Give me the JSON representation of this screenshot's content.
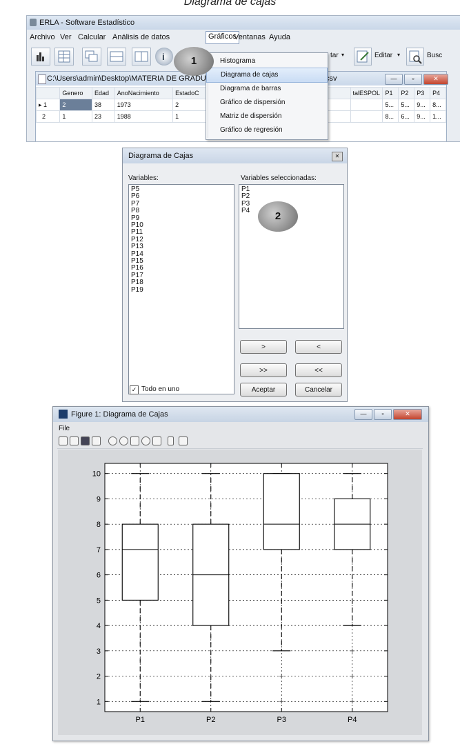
{
  "page_title": "Diagrama de cajas",
  "erla": {
    "title": "ERLA - Software Estadístico",
    "menu": [
      "Archivo",
      "Ver",
      "Calcular",
      "Análisis de datos",
      "Gráficos",
      "Ventanas",
      "Ayuda"
    ],
    "toolbar": {
      "editar_label": "Editar",
      "buscar_label": "Busc",
      "tar_label": "tar"
    },
    "data_window": {
      "title": "C:\\Users\\admin\\Desktop\\MATERIA DE GRADU",
      "title_suffix": "csv",
      "columns": [
        "Genero",
        "Edad",
        "AnoNacimiento",
        "EstadoC",
        "talESPOL",
        "P1",
        "P2",
        "P3",
        "P4"
      ],
      "rows": [
        {
          "idx": "1",
          "genero": "2",
          "edad": "38",
          "ano": "1973",
          "estado": "2",
          "p1": "5...",
          "p2": "5...",
          "p3": "9...",
          "p4": "8..."
        },
        {
          "idx": "2",
          "genero": "1",
          "edad": "23",
          "ano": "1988",
          "estado": "1",
          "p1": "8...",
          "p2": "6...",
          "p3": "9...",
          "p4": "1..."
        }
      ]
    }
  },
  "graficos_menu": {
    "items": [
      "Histograma",
      "Diagrama de cajas",
      "Diagrama de barras",
      "Gráfico de dispersión",
      "Matriz de dispersión",
      "Gráfico de regresión"
    ],
    "highlighted_index": 1
  },
  "badges": {
    "one": "1",
    "two": "2"
  },
  "dialog": {
    "title": "Diagrama de Cajas",
    "variables_label": "Variables:",
    "selected_label": "Variables seleccionadas:",
    "variables": [
      "P5",
      "P6",
      "P7",
      "P8",
      "P9",
      "P10",
      "P11",
      "P12",
      "P13",
      "P14",
      "P15",
      "P16",
      "P17",
      "P18",
      "P19"
    ],
    "selected": [
      "P1",
      "P2",
      "P3",
      "P4"
    ],
    "buttons": {
      "add": ">",
      "remove": "<",
      "add_all": ">>",
      "remove_all": "<<",
      "accept": "Aceptar",
      "cancel": "Cancelar"
    },
    "todo_en_uno": {
      "label": "Todo en uno",
      "checked": true
    }
  },
  "figure": {
    "title": "Figure 1: Diagrama de Cajas",
    "menu_file": "File"
  },
  "chart_data": {
    "type": "box",
    "categories": [
      "P1",
      "P2",
      "P3",
      "P4"
    ],
    "boxes": [
      {
        "name": "P1",
        "min": 1,
        "q1": 5,
        "median": 7,
        "q3": 8,
        "max": 10,
        "outliers": []
      },
      {
        "name": "P2",
        "min": 1,
        "q1": 4,
        "median": 6,
        "q3": 8,
        "max": 10,
        "outliers": []
      },
      {
        "name": "P3",
        "min": 3,
        "q1": 7,
        "median": 8,
        "q3": 10,
        "max": 10,
        "outliers": [
          2,
          1
        ]
      },
      {
        "name": "P4",
        "min": 4,
        "q1": 7,
        "median": 8,
        "q3": 9,
        "max": 10,
        "outliers": [
          3,
          2,
          1
        ]
      }
    ],
    "yticks": [
      1,
      2,
      3,
      4,
      5,
      6,
      7,
      8,
      9,
      10
    ],
    "ylim": [
      0.6,
      10.4
    ],
    "grid": true
  }
}
